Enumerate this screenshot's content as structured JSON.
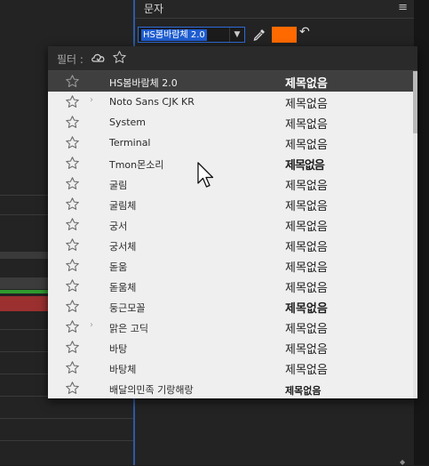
{
  "panel": {
    "title": "문자",
    "menu_icon": "hamburger-icon",
    "font_select_value": "HS봄바람체 2.0",
    "fill_color": "#ff6a00"
  },
  "filter": {
    "label": "필터 :",
    "cloud_icon": "cloud-sync-icon",
    "favorites_icon": "star-outline-icon"
  },
  "font_list": [
    {
      "name": "HS봄바람체 2.0",
      "sample": "제목없음",
      "selected": true,
      "has_submenu": false
    },
    {
      "name": "Noto Sans CJK KR",
      "sample": "제목없음",
      "selected": false,
      "has_submenu": true
    },
    {
      "name": "System",
      "sample": "제목없음",
      "selected": false,
      "has_submenu": false
    },
    {
      "name": "Terminal",
      "sample": "제목없음",
      "selected": false,
      "has_submenu": false
    },
    {
      "name": "Tmon몬소리",
      "sample": "제목없음",
      "selected": false,
      "has_submenu": false
    },
    {
      "name": "굴림",
      "sample": "제목없음",
      "selected": false,
      "has_submenu": false
    },
    {
      "name": "굴림체",
      "sample": "제목없음",
      "selected": false,
      "has_submenu": false
    },
    {
      "name": "궁서",
      "sample": "제목없음",
      "selected": false,
      "has_submenu": false
    },
    {
      "name": "궁서체",
      "sample": "제목없음",
      "selected": false,
      "has_submenu": false
    },
    {
      "name": "돋움",
      "sample": "제목없음",
      "selected": false,
      "has_submenu": false
    },
    {
      "name": "돋움체",
      "sample": "제목없음",
      "selected": false,
      "has_submenu": false
    },
    {
      "name": "둥근모꼴",
      "sample": "제목없음",
      "selected": false,
      "has_submenu": false
    },
    {
      "name": "맑은 고딕",
      "sample": "제목없음",
      "selected": false,
      "has_submenu": true
    },
    {
      "name": "바탕",
      "sample": "제목없음",
      "selected": false,
      "has_submenu": false
    },
    {
      "name": "바탕체",
      "sample": "제목없음",
      "selected": false,
      "has_submenu": false
    },
    {
      "name": "배달의민족 기랑해랑",
      "sample": "제목없음",
      "selected": false,
      "has_submenu": false
    }
  ]
}
